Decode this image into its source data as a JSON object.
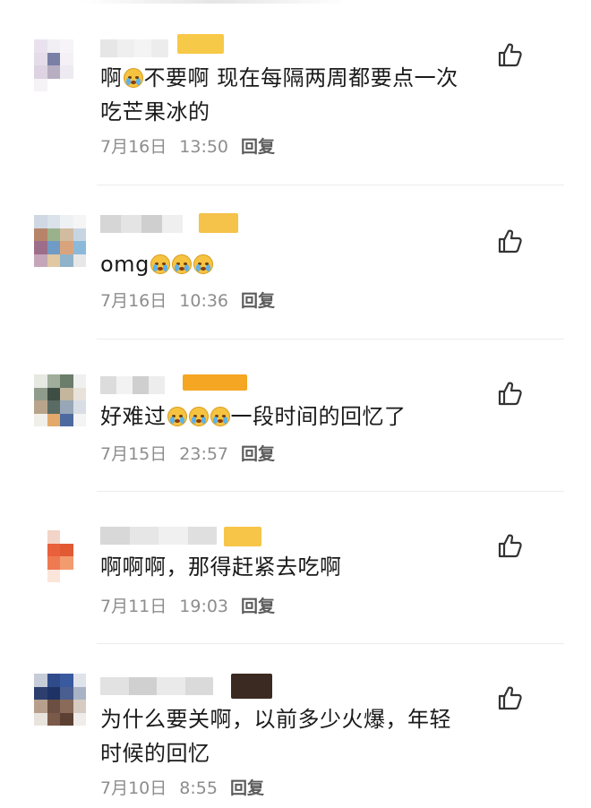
{
  "comments": [
    {
      "text_segments": [
        "啊",
        "不要啊 现在每隔两周都要点一次",
        "吃芒果冰的"
      ],
      "date": "7月16日",
      "time": "13:50",
      "reply_label": "回复",
      "avatar_colors": [
        "#e9e2ee",
        "#f1eef4",
        "#f6f4f8",
        "#ffffff",
        "#e4dde9",
        "#7a7fa6",
        "#f4f0f6",
        "#ffffff",
        "#ddd3e2",
        "#b8aec2",
        "#eeeaf1",
        "#ffffff",
        "#f6f3f7",
        "#ffffff",
        "#ffffff",
        "#ffffff"
      ],
      "name_blur_colors": [
        "#e6e6e6",
        "#efefef",
        "#f4f4f4",
        "#ececec"
      ],
      "badge_color": "#f7c948"
    },
    {
      "text_segments": [
        "omg"
      ],
      "date": "7月16日",
      "time": "10:36",
      "reply_label": "回复",
      "avatar_colors": [
        "#cfd8e3",
        "#dbe2ea",
        "#eef1f4",
        "#f5f5f5",
        "#b7846a",
        "#9ab28c",
        "#d1bca0",
        "#c7d5e2",
        "#9c6e8a",
        "#6f9bc4",
        "#d9a47c",
        "#8ab9d9",
        "#c4a6b8",
        "#e1c7a2",
        "#8fb3c8",
        "#e7e7e7"
      ],
      "name_blur_colors": [
        "#d6d6d6",
        "#e4e4e4",
        "#cfcfcf",
        "#efefef"
      ],
      "badge_color": "#f5c24a"
    },
    {
      "text_segments": [
        "好难过",
        "一段时间的回忆了"
      ],
      "date": "7月15日",
      "time": "23:57",
      "reply_label": "回复",
      "avatar_colors": [
        "#e5e9e2",
        "#9fad9a",
        "#6b7d6b",
        "#f0f0f0",
        "#8f9c8b",
        "#3f4e45",
        "#c4b59d",
        "#e8e3da",
        "#b7a48a",
        "#5a6b63",
        "#98a7b8",
        "#d9dee5",
        "#f1efe9",
        "#e3a96b",
        "#4d6aa0",
        "#f4f4f4"
      ],
      "name_blur_colors": [
        "#dcdcdc",
        "#f2f2f2",
        "#cfcfcf",
        "#ededed"
      ],
      "badge_color": "#f5a623"
    },
    {
      "text_segments": [
        "啊啊啊，那得赶紧去吃啊"
      ],
      "date": "7月11日",
      "time": "19:03",
      "reply_label": "回复",
      "avatar_colors": [
        "#ffffff",
        "#f3d4c8",
        "#ffffff",
        "#ffffff",
        "#ffffff",
        "#e8603c",
        "#e25a33",
        "#ffffff",
        "#ffffff",
        "#ee7a52",
        "#f29b6e",
        "#ffffff",
        "#ffffff",
        "#fbe5da",
        "#ffffff",
        "#ffffff"
      ],
      "name_blur_colors": [
        "#d8d8d8",
        "#e6e6e6",
        "#f0f0f0",
        "#dfdfdf"
      ],
      "badge_color": "#f7c548"
    },
    {
      "text_segments": [
        "为什么要关啊，以前多少火爆，年轻",
        "时候的回忆"
      ],
      "date": "7月10日",
      "time": "8:55",
      "reply_label": "回复",
      "avatar_colors": [
        "#c6ccd8",
        "#2f4b8a",
        "#3a5aa0",
        "#dfe3ea",
        "#2c3f6e",
        "#1e3266",
        "#4a5f8f",
        "#a9b3c6",
        "#b79f8c",
        "#6b4f42",
        "#8a6a58",
        "#d7cbc1",
        "#e9e3de",
        "#7b5a4a",
        "#5d4034",
        "#efece9"
      ],
      "name_blur_colors": [
        "#e2e2e2",
        "#d0d0d0",
        "#eaeaea",
        "#dadada"
      ],
      "badge_color": "#3b2a22"
    }
  ],
  "icons": {
    "like": "thumbs-up-icon",
    "emoji": "crying-face-icon"
  }
}
